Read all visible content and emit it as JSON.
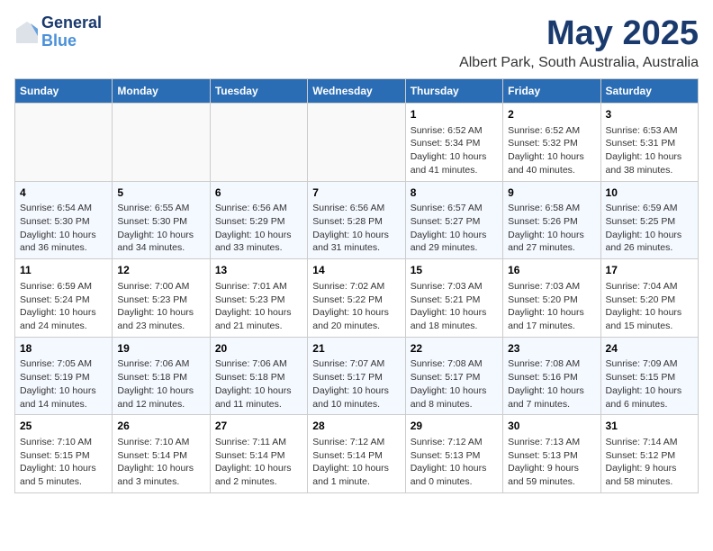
{
  "header": {
    "logo_line1": "General",
    "logo_line2": "Blue",
    "month_title": "May 2025",
    "subtitle": "Albert Park, South Australia, Australia"
  },
  "days_of_week": [
    "Sunday",
    "Monday",
    "Tuesday",
    "Wednesday",
    "Thursday",
    "Friday",
    "Saturday"
  ],
  "weeks": [
    [
      {
        "day": "",
        "info": ""
      },
      {
        "day": "",
        "info": ""
      },
      {
        "day": "",
        "info": ""
      },
      {
        "day": "",
        "info": ""
      },
      {
        "day": "1",
        "info": "Sunrise: 6:52 AM\nSunset: 5:34 PM\nDaylight: 10 hours and 41 minutes."
      },
      {
        "day": "2",
        "info": "Sunrise: 6:52 AM\nSunset: 5:32 PM\nDaylight: 10 hours and 40 minutes."
      },
      {
        "day": "3",
        "info": "Sunrise: 6:53 AM\nSunset: 5:31 PM\nDaylight: 10 hours and 38 minutes."
      }
    ],
    [
      {
        "day": "4",
        "info": "Sunrise: 6:54 AM\nSunset: 5:30 PM\nDaylight: 10 hours and 36 minutes."
      },
      {
        "day": "5",
        "info": "Sunrise: 6:55 AM\nSunset: 5:30 PM\nDaylight: 10 hours and 34 minutes."
      },
      {
        "day": "6",
        "info": "Sunrise: 6:56 AM\nSunset: 5:29 PM\nDaylight: 10 hours and 33 minutes."
      },
      {
        "day": "7",
        "info": "Sunrise: 6:56 AM\nSunset: 5:28 PM\nDaylight: 10 hours and 31 minutes."
      },
      {
        "day": "8",
        "info": "Sunrise: 6:57 AM\nSunset: 5:27 PM\nDaylight: 10 hours and 29 minutes."
      },
      {
        "day": "9",
        "info": "Sunrise: 6:58 AM\nSunset: 5:26 PM\nDaylight: 10 hours and 27 minutes."
      },
      {
        "day": "10",
        "info": "Sunrise: 6:59 AM\nSunset: 5:25 PM\nDaylight: 10 hours and 26 minutes."
      }
    ],
    [
      {
        "day": "11",
        "info": "Sunrise: 6:59 AM\nSunset: 5:24 PM\nDaylight: 10 hours and 24 minutes."
      },
      {
        "day": "12",
        "info": "Sunrise: 7:00 AM\nSunset: 5:23 PM\nDaylight: 10 hours and 23 minutes."
      },
      {
        "day": "13",
        "info": "Sunrise: 7:01 AM\nSunset: 5:23 PM\nDaylight: 10 hours and 21 minutes."
      },
      {
        "day": "14",
        "info": "Sunrise: 7:02 AM\nSunset: 5:22 PM\nDaylight: 10 hours and 20 minutes."
      },
      {
        "day": "15",
        "info": "Sunrise: 7:03 AM\nSunset: 5:21 PM\nDaylight: 10 hours and 18 minutes."
      },
      {
        "day": "16",
        "info": "Sunrise: 7:03 AM\nSunset: 5:20 PM\nDaylight: 10 hours and 17 minutes."
      },
      {
        "day": "17",
        "info": "Sunrise: 7:04 AM\nSunset: 5:20 PM\nDaylight: 10 hours and 15 minutes."
      }
    ],
    [
      {
        "day": "18",
        "info": "Sunrise: 7:05 AM\nSunset: 5:19 PM\nDaylight: 10 hours and 14 minutes."
      },
      {
        "day": "19",
        "info": "Sunrise: 7:06 AM\nSunset: 5:18 PM\nDaylight: 10 hours and 12 minutes."
      },
      {
        "day": "20",
        "info": "Sunrise: 7:06 AM\nSunset: 5:18 PM\nDaylight: 10 hours and 11 minutes."
      },
      {
        "day": "21",
        "info": "Sunrise: 7:07 AM\nSunset: 5:17 PM\nDaylight: 10 hours and 10 minutes."
      },
      {
        "day": "22",
        "info": "Sunrise: 7:08 AM\nSunset: 5:17 PM\nDaylight: 10 hours and 8 minutes."
      },
      {
        "day": "23",
        "info": "Sunrise: 7:08 AM\nSunset: 5:16 PM\nDaylight: 10 hours and 7 minutes."
      },
      {
        "day": "24",
        "info": "Sunrise: 7:09 AM\nSunset: 5:15 PM\nDaylight: 10 hours and 6 minutes."
      }
    ],
    [
      {
        "day": "25",
        "info": "Sunrise: 7:10 AM\nSunset: 5:15 PM\nDaylight: 10 hours and 5 minutes."
      },
      {
        "day": "26",
        "info": "Sunrise: 7:10 AM\nSunset: 5:14 PM\nDaylight: 10 hours and 3 minutes."
      },
      {
        "day": "27",
        "info": "Sunrise: 7:11 AM\nSunset: 5:14 PM\nDaylight: 10 hours and 2 minutes."
      },
      {
        "day": "28",
        "info": "Sunrise: 7:12 AM\nSunset: 5:14 PM\nDaylight: 10 hours and 1 minute."
      },
      {
        "day": "29",
        "info": "Sunrise: 7:12 AM\nSunset: 5:13 PM\nDaylight: 10 hours and 0 minutes."
      },
      {
        "day": "30",
        "info": "Sunrise: 7:13 AM\nSunset: 5:13 PM\nDaylight: 9 hours and 59 minutes."
      },
      {
        "day": "31",
        "info": "Sunrise: 7:14 AM\nSunset: 5:12 PM\nDaylight: 9 hours and 58 minutes."
      }
    ]
  ]
}
